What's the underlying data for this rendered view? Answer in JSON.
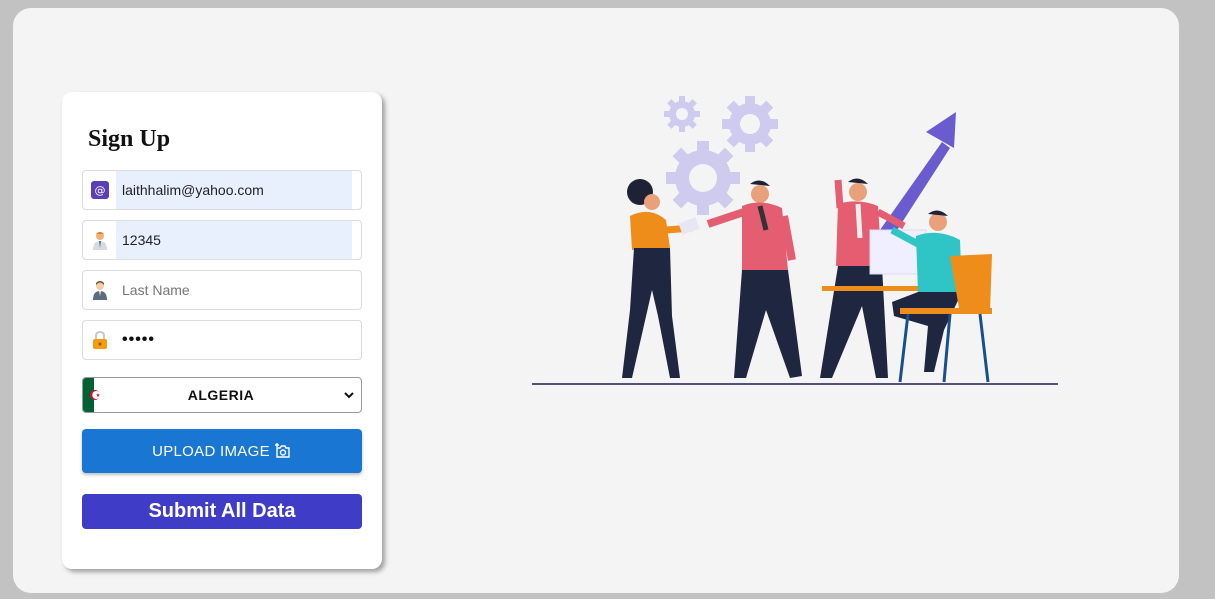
{
  "form": {
    "title": "Sign Up",
    "email": {
      "value": "laithhalim@yahoo.com",
      "icon": "at-sign-icon"
    },
    "first_name": {
      "value": "12345",
      "icon": "person-icon"
    },
    "last_name": {
      "placeholder": "Last Name",
      "icon": "person-icon"
    },
    "password": {
      "value": "•••••",
      "icon": "lock-icon"
    },
    "country": {
      "selected": "ALGERIA",
      "flag": "algeria-flag-icon"
    },
    "upload_label": "UPLOAD IMAGE",
    "submit_label": "Submit All Data"
  },
  "colors": {
    "background": "#c2c2c2",
    "panel": "#f4f4f4",
    "upload_button": "#1976d2",
    "submit_button": "#3f3dc8",
    "autofill": "#e8f0fe"
  }
}
